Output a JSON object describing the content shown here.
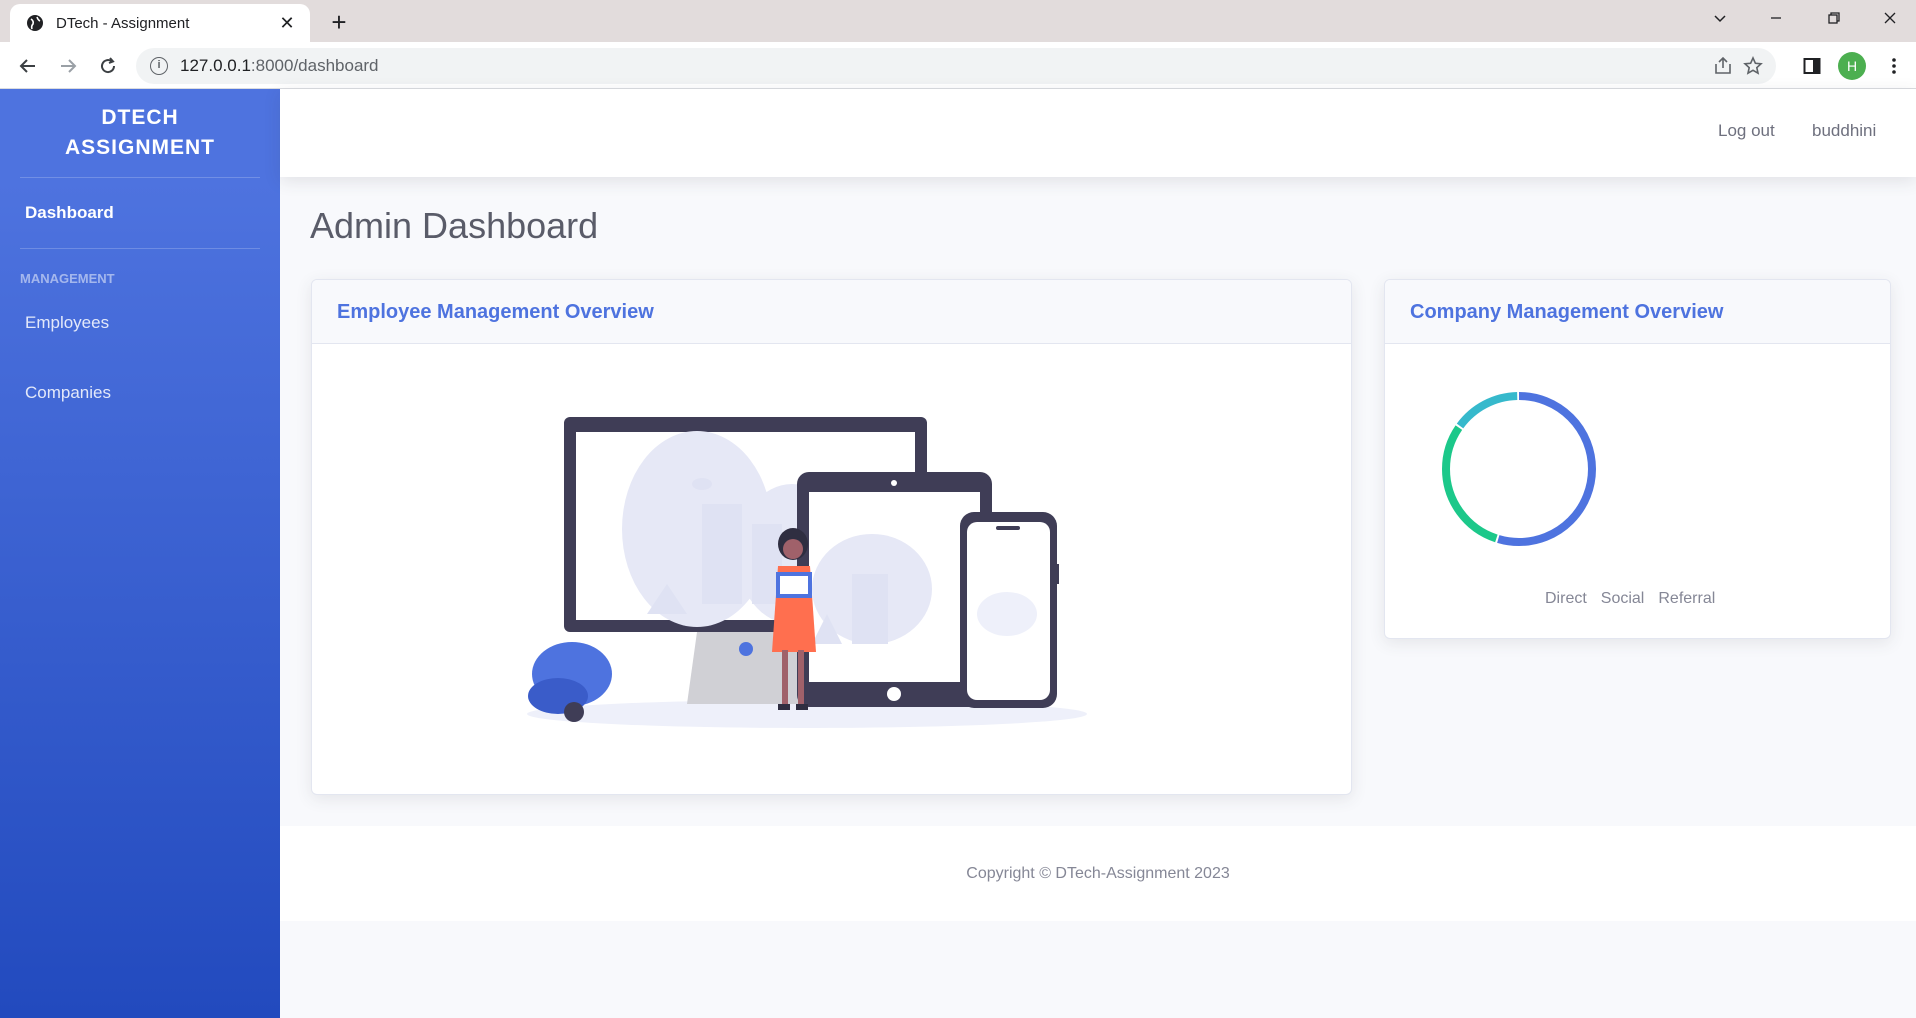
{
  "browser": {
    "tab_title": "DTech - Assignment",
    "tab_close": "✕",
    "new_tab": "+",
    "url_host": "127.0.0.1",
    "url_path": ":8000/dashboard",
    "profile_initial": "H"
  },
  "sidebar": {
    "brand_line1": "DTECH",
    "brand_line2": "ASSIGNMENT",
    "dashboard_label": "Dashboard",
    "section_heading": "MANAGEMENT",
    "items": [
      {
        "label": "Employees"
      },
      {
        "label": "Companies"
      }
    ]
  },
  "topbar": {
    "logout_label": "Log out",
    "username": "buddhini"
  },
  "main": {
    "page_title": "Admin Dashboard",
    "employee_card_title": "Employee Management Overview",
    "company_card_title": "Company Management Overview"
  },
  "chart_data": {
    "type": "pie",
    "variant": "doughnut",
    "categories": [
      "Direct",
      "Social",
      "Referral"
    ],
    "values": [
      55,
      30,
      15
    ],
    "colors": [
      "#4e73df",
      "#1cc88a",
      "#36b9cc"
    ],
    "legend_position": "bottom"
  },
  "footer": {
    "copyright": "Copyright © DTech-Assignment 2023"
  },
  "colors": {
    "primary": "#4e73df",
    "sidebar_gradient_end": "#224abe",
    "text_muted": "#858796"
  }
}
